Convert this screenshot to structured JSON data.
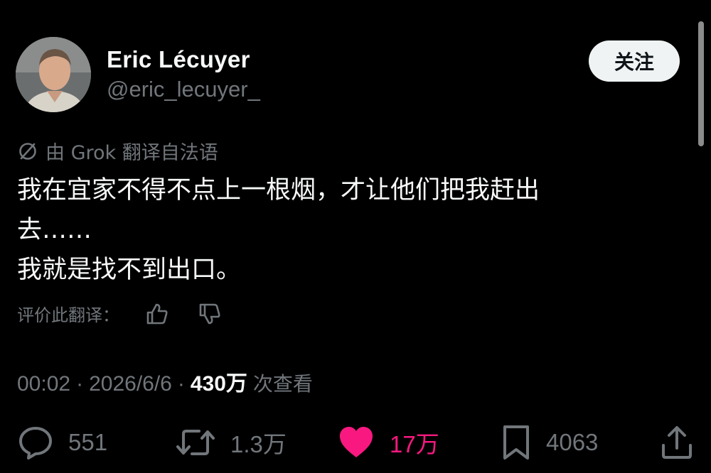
{
  "author": {
    "display_name": "Eric Lécuyer",
    "handle": "@eric_lecuyer_"
  },
  "follow_button": {
    "label": "关注"
  },
  "translation": {
    "note": "由 Grok 翻译自法语"
  },
  "tweet": {
    "lines": [
      "我在宜家不得不点上一根烟，才让他们把我赶出",
      "去……",
      "我就是找不到出口。"
    ]
  },
  "rate_translation": {
    "label": "评价此翻译："
  },
  "meta": {
    "time": "00:02",
    "date": "2026/6/6",
    "separator": "·",
    "views_count": "430万",
    "views_label": "次查看"
  },
  "actions": {
    "reply_count": "551",
    "retweet_count": "1.3万",
    "like_count": "17万",
    "bookmark_count": "4063"
  },
  "colors": {
    "background": "#000000",
    "text_primary": "#f7f9f9",
    "text_secondary": "#71767b",
    "like_accent": "#f91880",
    "follow_button_bg": "#eff3f4"
  },
  "icons": {
    "translate": "globe-slash-icon",
    "thumbs_up": "thumbs-up-icon",
    "thumbs_down": "thumbs-down-icon",
    "reply": "speech-bubble-icon",
    "retweet": "retweet-arrows-icon",
    "like": "heart-filled-icon",
    "bookmark": "bookmark-icon",
    "share": "share-upload-icon"
  }
}
